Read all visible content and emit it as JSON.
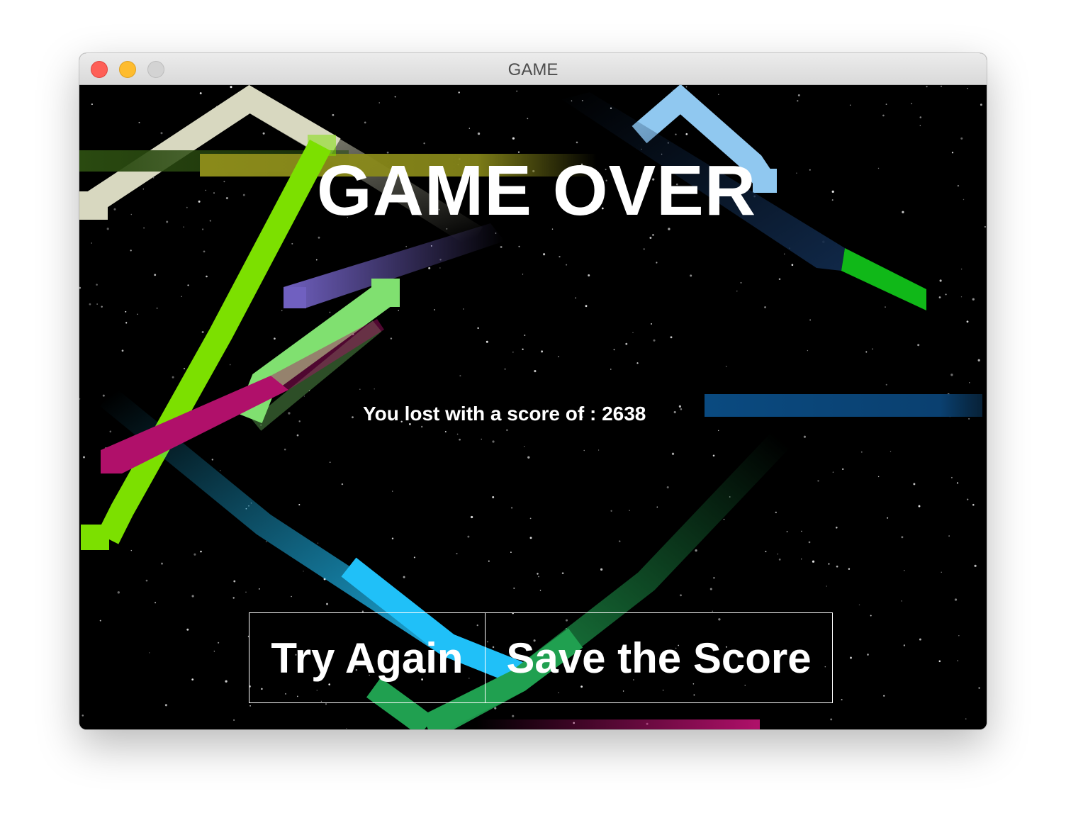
{
  "window": {
    "title": "GAME"
  },
  "game": {
    "heading": "GAME OVER",
    "score_text": "You lost with a score of : 2638",
    "score": 2638
  },
  "buttons": {
    "try_again": "Try Again",
    "save_score": "Save the Score"
  },
  "colors": {
    "background": "#000000",
    "text": "#ffffff",
    "snake_cream": "#d8d8c0",
    "snake_olive": "#8a8a1a",
    "snake_lime": "#7ce000",
    "snake_purple": "#7060c0",
    "snake_light_green": "#80e070",
    "snake_magenta": "#b0106a",
    "snake_cyan": "#20c0f8",
    "snake_dark_green": "#20a050",
    "snake_light_blue": "#90c8f0",
    "snake_navy": "#102848",
    "snake_green": "#10b818",
    "snake_steel_blue": "#0a4a80"
  }
}
